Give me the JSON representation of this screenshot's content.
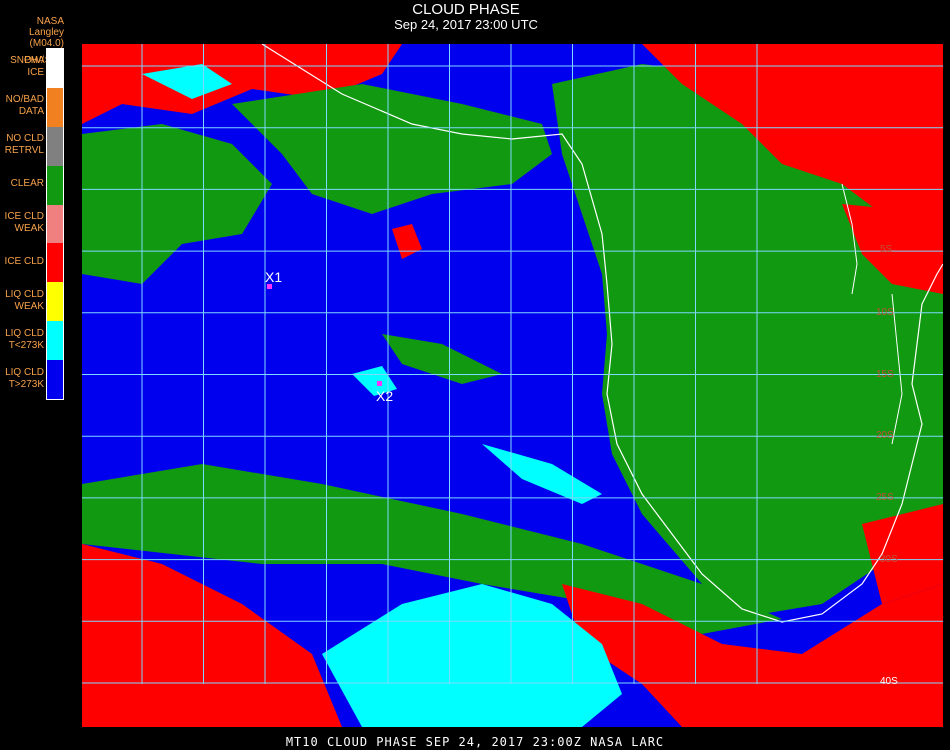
{
  "header": {
    "title": "CLOUD PHASE",
    "subtitle": "Sep 24, 2017 23:00 UTC",
    "source": "NASA Langley (M04.0)",
    "legend_title": "PHASE"
  },
  "legend": [
    {
      "label_1": "SNOW/",
      "label_2": "ICE",
      "color": "#ffffff"
    },
    {
      "label_1": "NO/BAD",
      "label_2": "DATA",
      "color": "#f08020"
    },
    {
      "label_1": "NO CLD",
      "label_2": "RETRVL",
      "color": "#808080"
    },
    {
      "label_1": "CLEAR",
      "label_2": "",
      "color": "#119911"
    },
    {
      "label_1": "ICE CLD",
      "label_2": "WEAK",
      "color": "#f08080"
    },
    {
      "label_1": "ICE CLD",
      "label_2": "",
      "color": "#ff0000"
    },
    {
      "label_1": "LIQ CLD",
      "label_2": "WEAK",
      "color": "#ffff00"
    },
    {
      "label_1": "LIQ CLD",
      "label_2": "T<273K",
      "color": "#00ffff"
    },
    {
      "label_1": "LIQ CLD",
      "label_2": "T>273K",
      "color": "#0000ee"
    }
  ],
  "markers": [
    {
      "label": "X1"
    },
    {
      "label": "X2"
    }
  ],
  "lat_labels": [
    "5S",
    "10S",
    "15S",
    "20S",
    "25S",
    "30S",
    "40S"
  ],
  "footer": "MT10  CLOUD PHASE   SEP 24, 2017 23:00Z  NASA LARC",
  "colors": {
    "ocean_liquid": "#0000ee",
    "clear": "#119911",
    "ice": "#ff0000",
    "liquid_cold": "#00ffff",
    "grid": "#7fd8ff",
    "coast": "#ffffff"
  }
}
